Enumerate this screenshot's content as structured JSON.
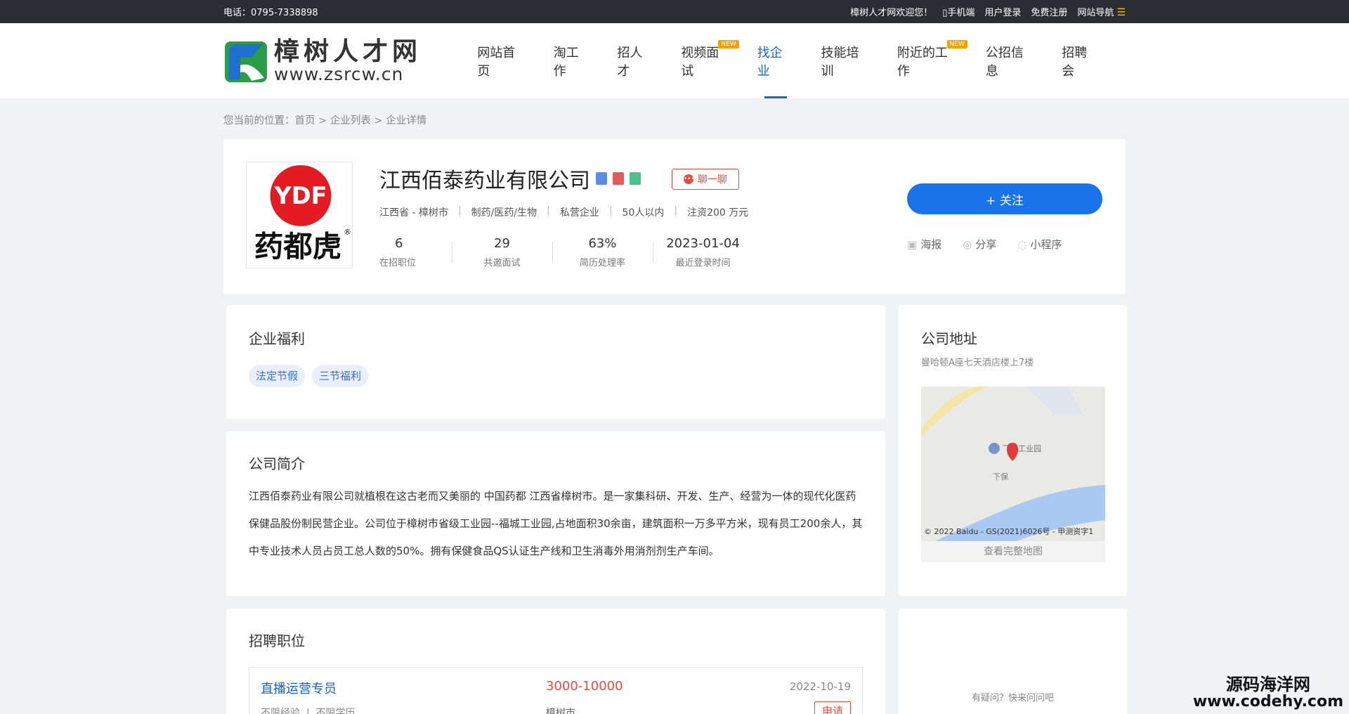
{
  "topbar": {
    "phone": "电话：0795-7338898",
    "welcome": "樟树人才网欢迎您！",
    "mobile": "手机端",
    "login": "用户登录",
    "register": "免费注册",
    "sitenav": "网站导航"
  },
  "logo": {
    "cn": "樟树人才网",
    "en": "www.zsrcw.cn"
  },
  "nav": [
    {
      "label": "网站首页"
    },
    {
      "label": "淘工作"
    },
    {
      "label": "招人才"
    },
    {
      "label": "视频面试",
      "badge": "NEW"
    },
    {
      "label": "找企业"
    },
    {
      "label": "技能培训"
    },
    {
      "label": "附近的工作",
      "badge": "NEW"
    },
    {
      "label": "公招信息"
    },
    {
      "label": "招聘会"
    }
  ],
  "breadcrumb": {
    "prefix": "您当前的位置：",
    "home": "首页",
    "sep": " > ",
    "list": "企业列表",
    "current": "企业详情"
  },
  "company": {
    "logo_text_top": "YDF",
    "logo_text_bottom": "药都虎",
    "name": "江西佰泰药业有限公司",
    "chat": "聊一聊",
    "meta": [
      "江西省 - 樟树市",
      "制药/医药/生物",
      "私营企业",
      "50人以内",
      "注资200 万元"
    ],
    "stats": [
      {
        "value": "6",
        "label": "在招职位"
      },
      {
        "value": "29",
        "label": "共邀面试"
      },
      {
        "value": "63%",
        "label": "简历处理率"
      },
      {
        "value": "2023-01-04",
        "label": "最近登录时间"
      }
    ],
    "follow": "+ 关注",
    "poster": "海报",
    "share": "分享",
    "miniapp": "小程序"
  },
  "welfare": {
    "title": "企业福利",
    "tags": [
      "法定节假",
      "三节福利"
    ]
  },
  "intro": {
    "title": "公司简介",
    "lines": [
      "江西佰泰药业有限公司就植根在这古老而又美丽的 中国药都 江西省樟树市。是一家集科研、开发、生产、经营为一体的现代化医药",
      "保健品股份制民营企业。公司位于樟树市省级工业园--福城工业园,占地面积30余亩，建筑面积一万多平方米，现有员工200余人，其",
      "中专业技术人员占员工总人数的50%。拥有保健食品QS认证生产线和卫生消毒外用消剂剂生产车间。"
    ]
  },
  "jobs": {
    "title": "招聘职位",
    "item": {
      "title": "直播运营专员",
      "salary": "3000-10000",
      "date": "2022-10-19",
      "exp": "不限经验",
      "edu": "不限学历",
      "city": "樟树市",
      "apply": "申请"
    }
  },
  "address": {
    "title": "公司地址",
    "text": "曼哈顿A座七天酒店楼上7楼",
    "map_poi": "飞山工业园",
    "map_place": "下保",
    "map_copyright": "© 2022 Baidu - GS(2021)6026号 - 甲测资字1",
    "map_link": "查看完整地图"
  },
  "help": {
    "text": "有疑问？快来问问吧"
  },
  "watermark": {
    "line1": "源码海洋网",
    "line2": "www.codehy.com"
  },
  "colors": {
    "accent": "#1d63d8",
    "follow": "#1a73e8",
    "salary": "#e74c3c"
  }
}
